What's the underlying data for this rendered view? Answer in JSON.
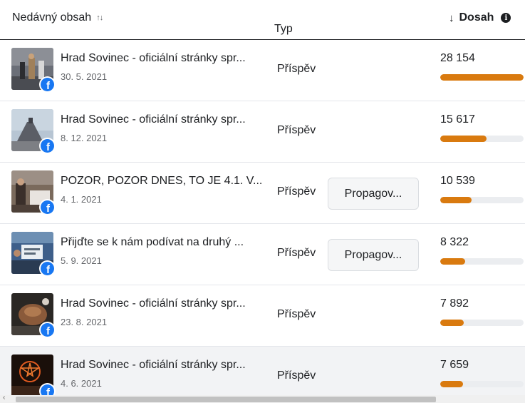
{
  "header": {
    "content_label": "Nedávný obsah",
    "typ_label": "Typ",
    "reach_label": "Dosah"
  },
  "colors": {
    "accent": "#d97a0f",
    "facebook": "#1877f2",
    "highlight": "#f2f3f5"
  },
  "rows": [
    {
      "title": "Hrad Sovinec - oficiální stránky spr...",
      "date": "30. 5. 2021",
      "type": "Příspěvek",
      "promote": "",
      "reach": "28 154",
      "reach_fraction": 1.0
    },
    {
      "title": "Hrad Sovinec - oficiální stránky spr...",
      "date": "8. 12. 2021",
      "type": "Příspěvek",
      "promote": "",
      "reach": "15 617",
      "reach_fraction": 0.555
    },
    {
      "title": "POZOR, POZOR DNES, TO JE 4.1. V...",
      "date": "4. 1. 2021",
      "type": "Příspěvek",
      "promote": "Propagov...",
      "reach": "10 539",
      "reach_fraction": 0.374
    },
    {
      "title": "Přijďte se k nám podívat na druhý ...",
      "date": "5. 9. 2021",
      "type": "Příspěvek",
      "promote": "Propagov...",
      "reach": "8 322",
      "reach_fraction": 0.296
    },
    {
      "title": "Hrad Sovinec - oficiální stránky spr...",
      "date": "23. 8. 2021",
      "type": "Příspěvek",
      "promote": "",
      "reach": "7 892",
      "reach_fraction": 0.28
    },
    {
      "title": "Hrad Sovinec - oficiální stránky spr...",
      "date": "4. 6. 2021",
      "type": "Příspěvek",
      "promote": "",
      "reach": "7 659",
      "reach_fraction": 0.272
    }
  ]
}
